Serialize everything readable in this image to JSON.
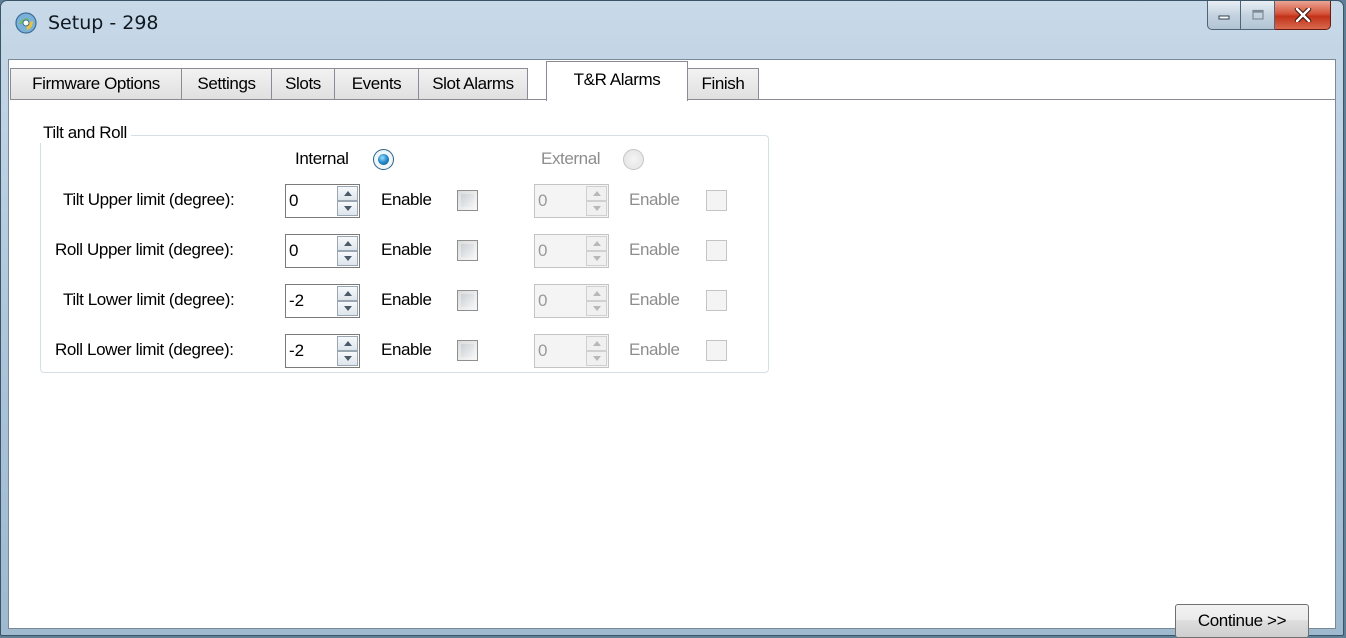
{
  "window": {
    "title": "Setup - 298"
  },
  "tabs": [
    {
      "label": "Firmware Options"
    },
    {
      "label": "Settings"
    },
    {
      "label": "Slots"
    },
    {
      "label": "Events"
    },
    {
      "label": "Slot Alarms"
    },
    {
      "label": "T&R Alarms",
      "active": true
    },
    {
      "label": "Finish"
    }
  ],
  "group": {
    "title": "Tilt and Roll",
    "internal_label": "Internal",
    "internal_selected": true,
    "external_label": "External",
    "external_selected": false,
    "external_enabled": false,
    "enable_label": "Enable",
    "rows": [
      {
        "label": "Tilt Upper limit (degree):",
        "internal_value": "0",
        "internal_enabled": false,
        "external_value": "0",
        "external_enabled": false
      },
      {
        "label": "Roll Upper limit (degree):",
        "internal_value": "0",
        "internal_enabled": false,
        "external_value": "0",
        "external_enabled": false
      },
      {
        "label": "Tilt Lower limit (degree):",
        "internal_value": "-2",
        "internal_enabled": false,
        "external_value": "0",
        "external_enabled": false
      },
      {
        "label": "Roll Lower limit (degree):",
        "internal_value": "-2",
        "internal_enabled": false,
        "external_value": "0",
        "external_enabled": false
      }
    ]
  },
  "buttons": {
    "continue_label": "Continue >>"
  },
  "icons": {
    "app": "setup-app-icon",
    "minimize": "minimize-icon",
    "maximize": "maximize-icon",
    "close": "close-icon"
  }
}
